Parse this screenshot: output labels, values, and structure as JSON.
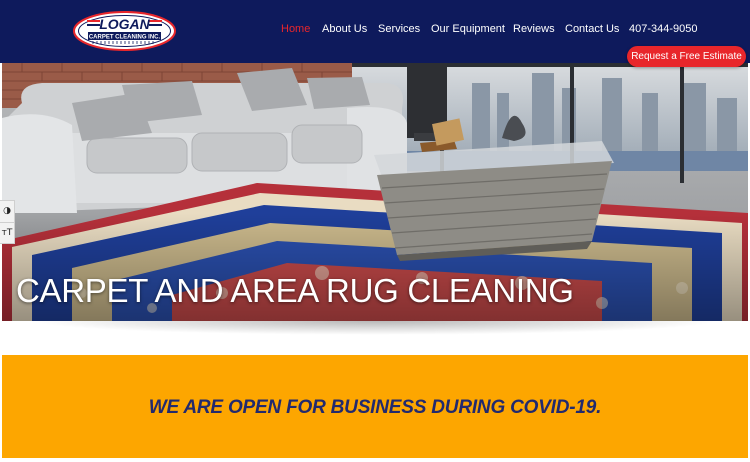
{
  "header": {
    "logo": {
      "name": "LOGAN",
      "tagline": "CARPET CLEANING INC."
    },
    "nav": [
      {
        "label": "Home",
        "active": true
      },
      {
        "label": "About Us",
        "active": false
      },
      {
        "label": "Services",
        "active": false
      },
      {
        "label": "Our Equipment",
        "active": false
      },
      {
        "label": "Reviews",
        "active": false
      },
      {
        "label": "Contact Us",
        "active": false
      },
      {
        "label": "407-344-9050",
        "active": false
      }
    ],
    "cta_label": "Request a Free Estimate"
  },
  "hero": {
    "title": "CARPET AND AREA RUG CLEANING"
  },
  "accessibility": {
    "contrast_icon": "contrast-icon",
    "font_size_icon": "text-size-icon",
    "contrast_glyph": "◑",
    "font_size_glyph": "ᴛT"
  },
  "banner": {
    "text": "WE ARE OPEN FOR BUSINESS DURING COVID-19."
  },
  "colors": {
    "header_bg": "#0e1a5c",
    "accent_red": "#e8262b",
    "banner_bg": "#fda600",
    "banner_text": "#222a6e"
  }
}
